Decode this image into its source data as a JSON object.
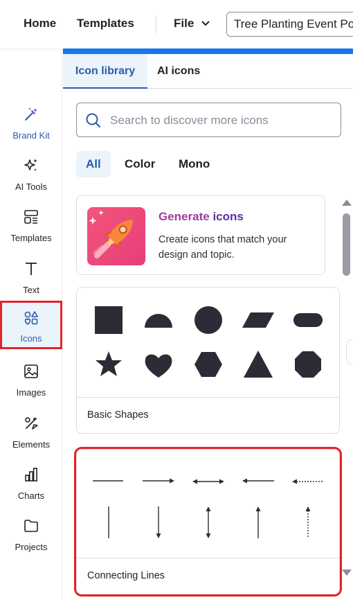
{
  "header": {
    "home": "Home",
    "templates": "Templates",
    "file": "File",
    "doc_title": "Tree Planting Event Po"
  },
  "sidebar": {
    "items": [
      {
        "label": "Brand Kit",
        "icon": "magic-wand-icon"
      },
      {
        "label": "AI Tools",
        "icon": "sparkles-icon"
      },
      {
        "label": "Templates",
        "icon": "templates-icon"
      },
      {
        "label": "Text",
        "icon": "text-icon"
      },
      {
        "label": "Icons",
        "icon": "shapes-icon",
        "active": true
      },
      {
        "label": "Images",
        "icon": "image-icon"
      },
      {
        "label": "Elements",
        "icon": "elements-icon"
      },
      {
        "label": "Charts",
        "icon": "bar-chart-icon"
      },
      {
        "label": "Projects",
        "icon": "folder-icon"
      }
    ]
  },
  "panel": {
    "tabs": [
      "Icon library",
      "AI icons"
    ],
    "search_placeholder": "Search to discover more icons",
    "filters": [
      "All",
      "Color",
      "Mono"
    ],
    "generate": {
      "title_part1": "Generate",
      "title_part2": "icons",
      "description": "Create icons that match your design and topic."
    },
    "categories": [
      {
        "name": "Basic Shapes"
      },
      {
        "name": "Connecting Lines"
      }
    ]
  },
  "colors": {
    "accent": "#2a5ca8",
    "highlight": "#e2242b",
    "top_line": "#1877f2",
    "shape_fill": "#2b2c35"
  }
}
